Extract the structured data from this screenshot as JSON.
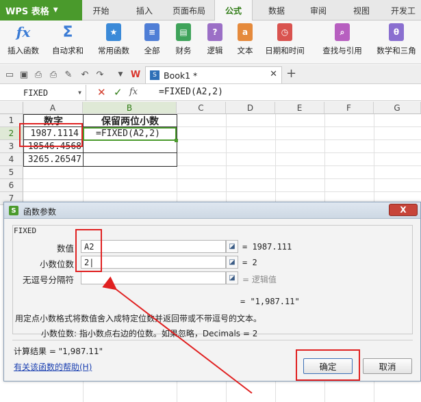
{
  "app": {
    "logo": "WPS 表格"
  },
  "tabs": [
    "开始",
    "插入",
    "页面布局",
    "公式",
    "数据",
    "审阅",
    "视图",
    "开发工"
  ],
  "active_tab": "公式",
  "ribbon": {
    "insert_function": "插入函数",
    "autosum": "自动求和",
    "common_functions": "常用函数",
    "all": "全部",
    "finance": "财务",
    "logic": "逻辑",
    "text": "文本",
    "datetime": "日期和时间",
    "lookup": "查找与引用",
    "math": "数学和三角"
  },
  "document": {
    "tab_title": "Book1 *"
  },
  "formula_bar": {
    "name_box": "FIXED",
    "formula": "=FIXED(A2,2)"
  },
  "columns": [
    "A",
    "B",
    "C",
    "D",
    "E",
    "F",
    "G"
  ],
  "rows": [
    "1",
    "2",
    "3",
    "4",
    "5",
    "6",
    "7"
  ],
  "cells": {
    "a1": "数字",
    "b1": "保留两位小数",
    "a2": "1987.1114",
    "b2": "=FIXED(A2,2)",
    "a3": "18546.4568",
    "a4": "3265.26547"
  },
  "dialog": {
    "title": "函数参数",
    "close": "X",
    "function_name": "FIXED",
    "params": [
      {
        "label": "数值",
        "value": "A2",
        "result": "= 1987.111"
      },
      {
        "label": "小数位数",
        "value": "2|",
        "result": "= 2"
      },
      {
        "label": "无逗号分隔符",
        "value": "",
        "result": "= 逻辑值"
      }
    ],
    "formula_result": "= \"1,987.11\"",
    "description": "用定点小数格式将数值舍入成特定位数并返回带或不带逗号的文本。",
    "param_description": "小数位数:  指小数点右边的位数。如果忽略，Decimals = 2",
    "calc_result": "计算结果 = \"1,987.11\"",
    "help_link": "有关该函数的帮助(H)",
    "ok": "确定",
    "cancel": "取消"
  },
  "colors": {
    "accent": "#4a9a2c",
    "highlight": "#e02020",
    "link": "#1a3fb0"
  }
}
